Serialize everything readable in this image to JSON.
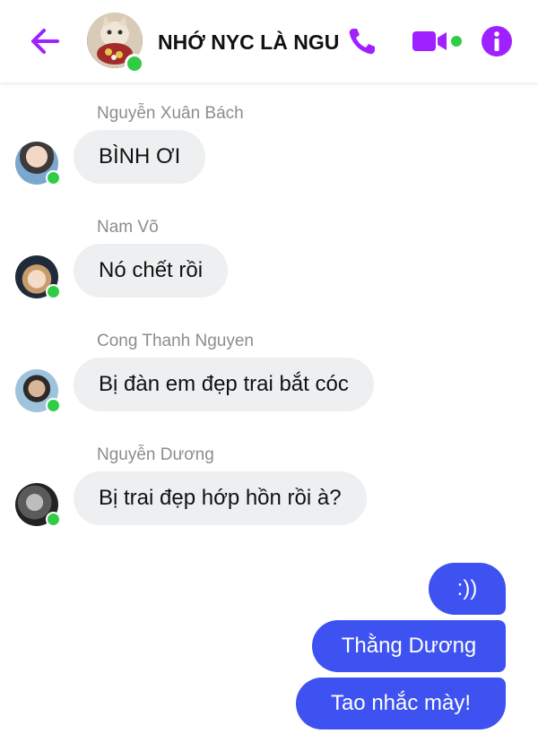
{
  "header": {
    "title": "NHỚ NYC LÀ NGU",
    "icons": {
      "back": "back-arrow-icon",
      "phone": "phone-icon",
      "video": "video-camera-icon",
      "info": "info-icon"
    }
  },
  "colors": {
    "accent": "#a021ff",
    "incoming_bubble": "#eeeff1",
    "outgoing_bubble": "#3d52f0",
    "online": "#31cc46",
    "sender_name": "#8a8d91"
  },
  "messages": [
    {
      "sender": "Nguyễn Xuân Bách",
      "text": "BÌNH ƠI"
    },
    {
      "sender": "Nam Võ",
      "text": "Nó chết rồi"
    },
    {
      "sender": "Cong Thanh Nguyen",
      "text": "Bị đàn em đẹp trai bắt cóc"
    },
    {
      "sender": "Nguyễn Dương",
      "text": "Bị trai đẹp hớp hồn rồi à?"
    }
  ],
  "outgoing": [
    {
      "text": ":))"
    },
    {
      "text": "Thằng Dương"
    },
    {
      "text": "Tao nhắc mày!"
    }
  ]
}
